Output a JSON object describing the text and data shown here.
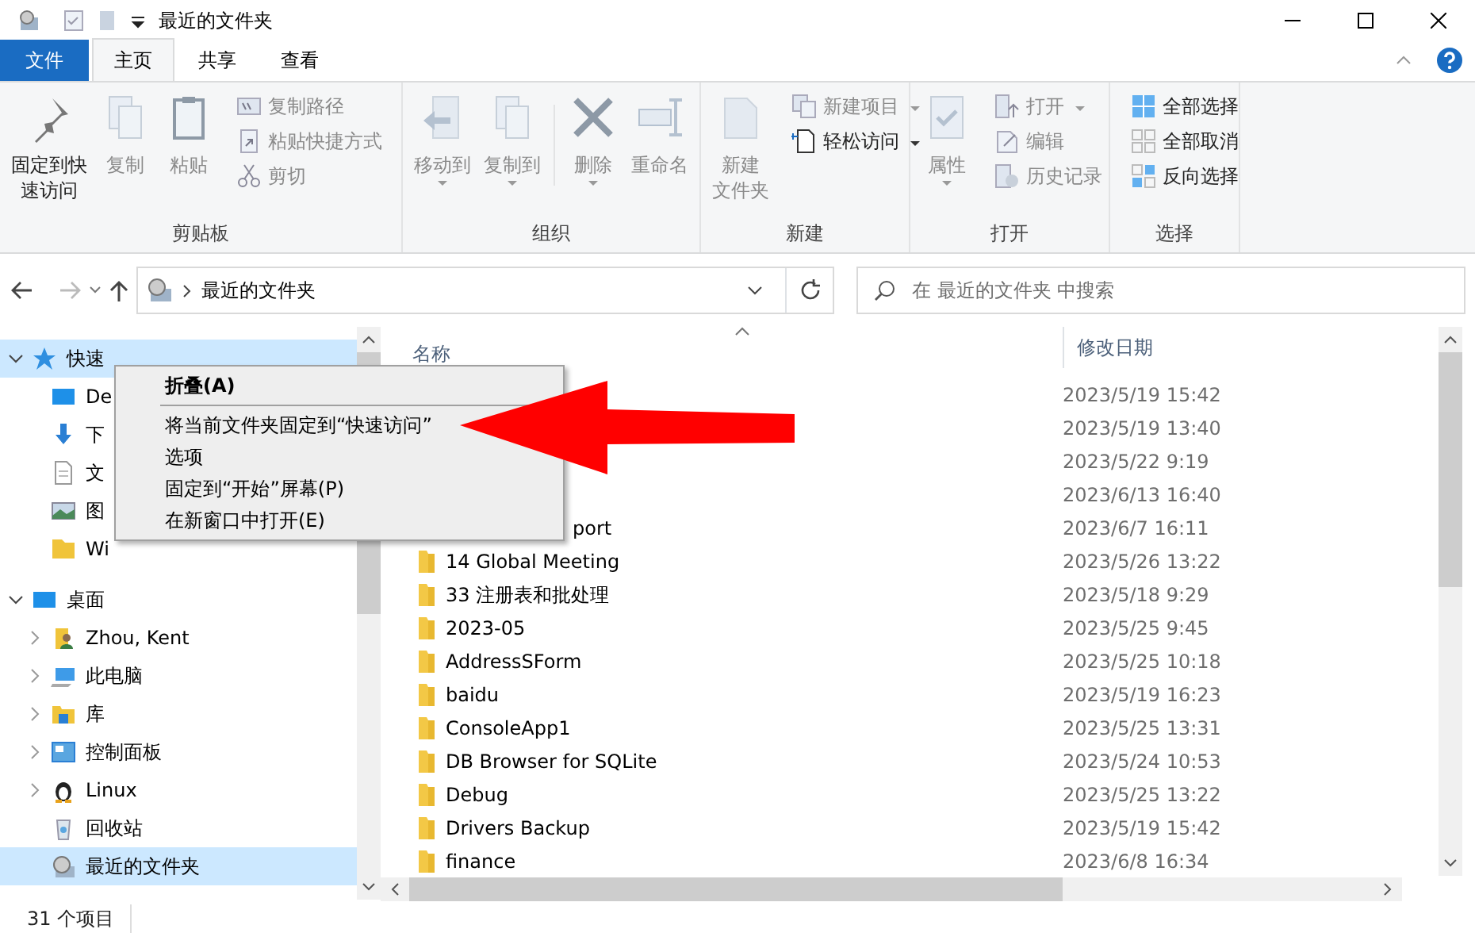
{
  "window": {
    "title": "最近的文件夹"
  },
  "ribbon_tabs": [
    {
      "label": "文件",
      "kind": "file",
      "selected": false
    },
    {
      "label": "主页",
      "kind": "tab",
      "selected": true
    },
    {
      "label": "共享",
      "kind": "tab",
      "selected": false
    },
    {
      "label": "查看",
      "kind": "tab",
      "selected": false
    }
  ],
  "ribbon": {
    "groups": [
      {
        "label": "剪贴板",
        "items": [
          {
            "kind": "large",
            "label": [
              "固定到快",
              "速访问"
            ],
            "disabled": false,
            "has_menu": false
          },
          {
            "kind": "large",
            "label": [
              "复制"
            ],
            "disabled": true,
            "has_menu": false
          },
          {
            "kind": "large",
            "label": [
              "粘贴"
            ],
            "disabled": true,
            "has_menu": false
          },
          {
            "kind": "stack",
            "buttons": [
              {
                "label": "复制路径",
                "disabled": true,
                "has_menu": false
              },
              {
                "label": "粘贴快捷方式",
                "disabled": true,
                "has_menu": false
              },
              {
                "label": "剪切",
                "disabled": true,
                "has_menu": false
              }
            ]
          }
        ]
      },
      {
        "label": "组织",
        "items": [
          {
            "kind": "large",
            "label": [
              "移动到"
            ],
            "disabled": true,
            "has_menu": true
          },
          {
            "kind": "large",
            "label": [
              "复制到"
            ],
            "disabled": true,
            "has_menu": true
          },
          {
            "kind": "separator"
          },
          {
            "kind": "large",
            "label": [
              "删除"
            ],
            "disabled": true,
            "has_menu": true
          },
          {
            "kind": "large",
            "label": [
              "重命名"
            ],
            "disabled": true,
            "has_menu": false
          }
        ]
      },
      {
        "label": "新建",
        "items": [
          {
            "kind": "large",
            "label": [
              "新建",
              "文件夹"
            ],
            "disabled": true,
            "has_menu": false
          },
          {
            "kind": "stack",
            "buttons": [
              {
                "label": "新建项目",
                "disabled": true,
                "has_menu": true
              },
              {
                "label": "轻松访问",
                "disabled": false,
                "has_menu": true
              }
            ]
          }
        ]
      },
      {
        "label": "打开",
        "items": [
          {
            "kind": "large",
            "label": [
              "属性"
            ],
            "disabled": true,
            "has_menu": true
          },
          {
            "kind": "stack",
            "buttons": [
              {
                "label": "打开",
                "disabled": true,
                "has_menu": true
              },
              {
                "label": "编辑",
                "disabled": true,
                "has_menu": false
              },
              {
                "label": "历史记录",
                "disabled": true,
                "has_menu": false
              }
            ]
          }
        ]
      },
      {
        "label": "选择",
        "items": [
          {
            "kind": "stack",
            "buttons": [
              {
                "label": "全部选择",
                "disabled": false,
                "has_menu": false
              },
              {
                "label": "全部取消",
                "disabled": false,
                "has_menu": false
              },
              {
                "label": "反向选择",
                "disabled": false,
                "has_menu": false
              }
            ]
          }
        ]
      }
    ]
  },
  "address_bar": {
    "path": [
      "最近的文件夹"
    ]
  },
  "search": {
    "placeholder": "在 最近的文件夹 中搜索"
  },
  "navigation_tree": [
    {
      "label": "快速",
      "expanded": true,
      "selected": true,
      "children": [
        {
          "label": "De",
          "selected": false
        },
        {
          "label": "下",
          "selected": false
        },
        {
          "label": "文",
          "selected": false
        },
        {
          "label": "图",
          "selected": false
        },
        {
          "label": "Wi",
          "selected": false
        }
      ]
    },
    {
      "label": "桌面",
      "expanded": true,
      "selected": false,
      "children": [
        {
          "label": "Zhou, Kent",
          "kind": "node",
          "expanded": false,
          "selected": false
        },
        {
          "label": "此电脑",
          "kind": "node",
          "expanded": false,
          "selected": false
        },
        {
          "label": "库",
          "kind": "node",
          "expanded": false,
          "selected": false
        },
        {
          "label": "控制面板",
          "kind": "node",
          "expanded": false,
          "selected": false
        },
        {
          "label": "Linux",
          "kind": "node",
          "expanded": false,
          "selected": false
        },
        {
          "label": "回收站",
          "kind": "leaf",
          "selected": false
        },
        {
          "label": "最近的文件夹",
          "kind": "leaf",
          "selected": true
        }
      ]
    }
  ],
  "file_list": {
    "columns": [
      "名称",
      "修改日期"
    ],
    "rows": [
      {
        "date": "2023/5/19 15:42"
      },
      {
        "date": "2023/5/19 13:40"
      },
      {
        "date": "2023/5/22 9:19"
      },
      {
        "date": "2023/6/13 16:40"
      },
      {
        "name": "port",
        "obscured": true,
        "date": "2023/6/7 16:11"
      },
      {
        "name": "14 Global Meeting",
        "obscured": false,
        "date": "2023/5/26 13:22"
      },
      {
        "name": "33 注册表和批处理",
        "obscured": false,
        "date": "2023/5/18 9:29"
      },
      {
        "name": "2023-05",
        "obscured": false,
        "date": "2023/5/25 9:45"
      },
      {
        "name": "AddressSForm",
        "obscured": false,
        "date": "2023/5/25 10:18"
      },
      {
        "name": "baidu",
        "obscured": false,
        "date": "2023/5/19 16:23"
      },
      {
        "name": "ConsoleApp1",
        "obscured": false,
        "date": "2023/5/25 13:31"
      },
      {
        "name": "DB Browser for SQLite",
        "obscured": false,
        "date": "2023/5/24 10:53"
      },
      {
        "name": "Debug",
        "obscured": false,
        "date": "2023/5/25 13:22"
      },
      {
        "name": "Drivers Backup",
        "obscured": false,
        "date": "2023/5/19 15:42"
      },
      {
        "name": "finance",
        "obscured": false,
        "date": "2023/6/8 16:34"
      }
    ]
  },
  "status_bar": {
    "item_count": "31 个项目"
  },
  "context_menu": {
    "items": [
      {
        "label": "折叠(A)",
        "kind": "default"
      },
      {
        "kind": "separator"
      },
      {
        "label": "将当前文件夹固定到“快速访问”",
        "kind": "item"
      },
      {
        "label": "选项",
        "kind": "item"
      },
      {
        "label": "固定到“开始”屏幕(P)",
        "kind": "item"
      },
      {
        "label": "在新窗口中打开(E)",
        "kind": "item"
      }
    ]
  }
}
